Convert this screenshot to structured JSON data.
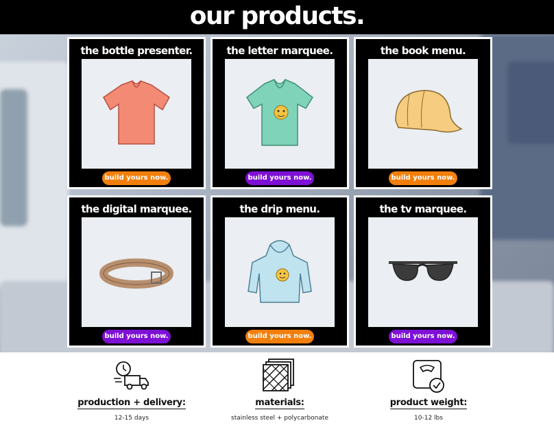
{
  "header": {
    "title": "our products."
  },
  "products": [
    {
      "name": "the bottle presenter.",
      "button": "build yours now.",
      "button_color": "#f27f0c",
      "image": "orange-tshirt"
    },
    {
      "name": "the letter marquee.",
      "button": "build yours now.",
      "button_color": "#7e10d6",
      "image": "green-tshirt-emoji"
    },
    {
      "name": "the book menu.",
      "button": "build yours now.",
      "button_color": "#f27f0c",
      "image": "yellow-cap"
    },
    {
      "name": "the digital marquee.",
      "button": "build yours now.",
      "button_color": "#7e10d6",
      "image": "brown-belt"
    },
    {
      "name": "the drip menu.",
      "button": "build yours now.",
      "button_color": "#f27f0c",
      "image": "blue-hoodie-emoji"
    },
    {
      "name": "the tv marquee.",
      "button": "build yours now.",
      "button_color": "#7e10d6",
      "image": "sunglasses"
    }
  ],
  "features": [
    {
      "title": "production + delivery:",
      "value": "12-15 days",
      "icon": "delivery-truck-clock-icon"
    },
    {
      "title": "materials:",
      "value": "stainless steel + polycarbonate",
      "icon": "materials-layers-icon"
    },
    {
      "title": "product weight:",
      "value": "10-12 lbs",
      "icon": "weight-scale-icon"
    }
  ],
  "colors": {
    "accent_orange": "#f27f0c",
    "accent_purple": "#7e10d6",
    "topbar": "#000000"
  }
}
